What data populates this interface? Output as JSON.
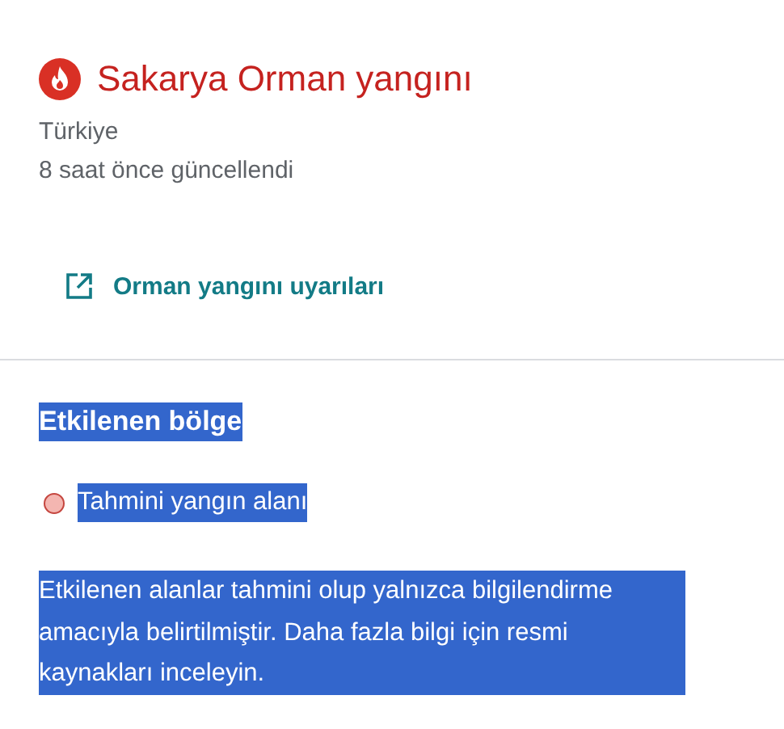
{
  "header": {
    "title": "Sakarya Orman yangını",
    "location": "Türkiye",
    "updated": "8 saat önce güncellendi"
  },
  "link": {
    "label": "Orman yangını uyarıları"
  },
  "affected_area": {
    "highlighted": true,
    "heading": "Etkilenen bölge",
    "legend": [
      {
        "label": "Tahmini yangın alanı",
        "color": "#f4b6b1"
      }
    ],
    "note": "Etkilenen alanlar tahmini olup yalnızca bilgilendirme amacıyla belirtilmiştir. Daha fazla bilgi için resmi kaynakları inceleyin."
  }
}
